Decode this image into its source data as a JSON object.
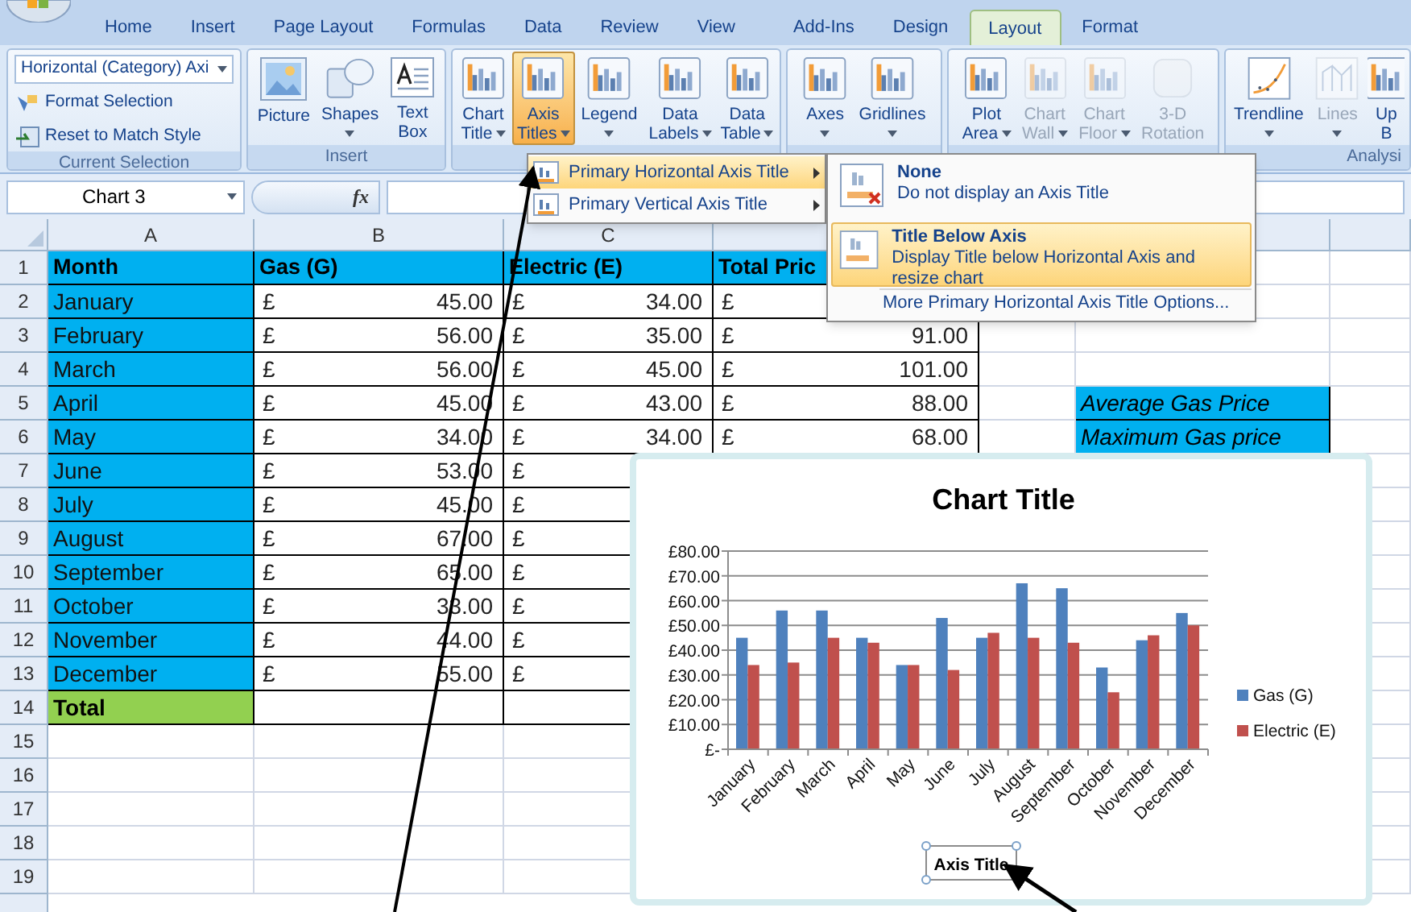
{
  "tabs": [
    {
      "label": "Home",
      "selected": false
    },
    {
      "label": "Insert",
      "selected": false
    },
    {
      "label": "Page Layout",
      "selected": false
    },
    {
      "label": "Formulas",
      "selected": false
    },
    {
      "label": "Data",
      "selected": false
    },
    {
      "label": "Review",
      "selected": false
    },
    {
      "label": "View",
      "selected": false
    },
    {
      "label": "Add-Ins",
      "selected": false
    },
    {
      "label": "Design",
      "selected": false
    },
    {
      "label": "Layout",
      "selected": true
    },
    {
      "label": "Format",
      "selected": false
    }
  ],
  "ribbon": {
    "groups": [
      {
        "kind": "selection",
        "label": "Current Selection",
        "dropdown": "Horizontal (Category) Axi",
        "commands": [
          "Format Selection",
          "Reset to Match Style"
        ]
      },
      {
        "kind": "buttons",
        "label": "Insert",
        "buttons": [
          {
            "kind": "picture",
            "lines": [
              "Picture"
            ],
            "dropdown": false,
            "pressed": false,
            "disabled": false
          },
          {
            "kind": "shapes",
            "lines": [
              "Shapes"
            ],
            "dropdown": true,
            "pressed": false,
            "disabled": false
          },
          {
            "kind": "text",
            "lines": [
              "Text",
              "Box"
            ],
            "dropdown": false,
            "pressed": false,
            "disabled": false
          }
        ]
      },
      {
        "kind": "buttons",
        "buttons": [
          {
            "kind": "chart",
            "lines": [
              "Chart",
              "Title"
            ],
            "dropdown": true,
            "pressed": false,
            "disabled": false
          },
          {
            "kind": "chart",
            "lines": [
              "Axis",
              "Titles"
            ],
            "dropdown": true,
            "pressed": true,
            "disabled": false
          },
          {
            "kind": "chart",
            "lines": [
              "Legend"
            ],
            "dropdown": true,
            "pressed": false,
            "disabled": false
          },
          {
            "kind": "chart",
            "lines": [
              "Data",
              "Labels"
            ],
            "dropdown": true,
            "pressed": false,
            "disabled": false
          },
          {
            "kind": "chart",
            "lines": [
              "Data",
              "Table"
            ],
            "dropdown": true,
            "pressed": false,
            "disabled": false
          }
        ]
      },
      {
        "kind": "buttons",
        "buttons": [
          {
            "kind": "chart",
            "lines": [
              "Axes"
            ],
            "dropdown": true,
            "pressed": false,
            "disabled": false
          },
          {
            "kind": "chart",
            "lines": [
              "Gridlines"
            ],
            "dropdown": true,
            "pressed": false,
            "disabled": false
          }
        ]
      },
      {
        "kind": "buttons",
        "buttons": [
          {
            "kind": "chart",
            "lines": [
              "Plot",
              "Area"
            ],
            "dropdown": true,
            "pressed": false,
            "disabled": false
          },
          {
            "kind": "chart",
            "lines": [
              "Chart",
              "Wall"
            ],
            "dropdown": true,
            "pressed": false,
            "disabled": true
          },
          {
            "kind": "chart",
            "lines": [
              "Chart",
              "Floor"
            ],
            "dropdown": true,
            "pressed": false,
            "disabled": true
          },
          {
            "kind": "cube",
            "lines": [
              "3-D",
              "Rotation"
            ],
            "dropdown": false,
            "pressed": false,
            "disabled": true
          }
        ]
      },
      {
        "kind": "buttons",
        "label": "Analysi",
        "buttons": [
          {
            "kind": "trend",
            "lines": [
              "Trendline"
            ],
            "dropdown": true,
            "pressed": false,
            "disabled": false
          },
          {
            "kind": "lines",
            "lines": [
              "Lines"
            ],
            "dropdown": true,
            "pressed": false,
            "disabled": true
          },
          {
            "kind": "chart",
            "lines": [
              "Up",
              "B"
            ],
            "dropdown": false,
            "pressed": false,
            "disabled": false
          }
        ]
      }
    ]
  },
  "formula_bar": {
    "name_box": "Chart 3",
    "function_label": "fx"
  },
  "sheet": {
    "columns": [
      "A",
      "B",
      "C"
    ],
    "rows": [
      {
        "number": "1",
        "cells": [
          {
            "kind": "header",
            "text": "Month"
          },
          {
            "kind": "header",
            "text": "Gas (G)"
          },
          {
            "kind": "header",
            "text": "Electric (E)"
          },
          {
            "kind": "header",
            "text": "Total Pric"
          },
          {
            "kind": "covered"
          },
          {
            "kind": "partly_covered"
          },
          {
            "kind": "blank"
          }
        ]
      },
      {
        "number": "2",
        "cells": [
          {
            "kind": "month",
            "text": "January"
          },
          {
            "kind": "currency",
            "symbol": "£",
            "value": "45.00"
          },
          {
            "kind": "currency",
            "symbol": "£",
            "value": "34.00"
          },
          {
            "kind": "currency",
            "symbol": "£"
          },
          {
            "kind": "covered"
          },
          {
            "kind": "partly_covered"
          },
          {
            "kind": "blank"
          }
        ]
      },
      {
        "number": "3",
        "cells": [
          {
            "kind": "month",
            "text": "February"
          },
          {
            "kind": "currency",
            "symbol": "£",
            "value": "56.00"
          },
          {
            "kind": "currency",
            "symbol": "£",
            "value": "35.00"
          },
          {
            "kind": "currency",
            "symbol": "£",
            "value": "91.00"
          },
          {
            "kind": "blank"
          },
          {
            "kind": "blank"
          },
          {
            "kind": "blank"
          }
        ]
      },
      {
        "number": "4",
        "cells": [
          {
            "kind": "month",
            "text": "March"
          },
          {
            "kind": "currency",
            "symbol": "£",
            "value": "56.00"
          },
          {
            "kind": "currency",
            "symbol": "£",
            "value": "45.00"
          },
          {
            "kind": "currency",
            "symbol": "£",
            "value": "101.00"
          },
          {
            "kind": "blank"
          },
          {
            "kind": "blank"
          },
          {
            "kind": "blank"
          }
        ]
      },
      {
        "number": "5",
        "cells": [
          {
            "kind": "month",
            "text": "April"
          },
          {
            "kind": "currency",
            "symbol": "£",
            "value": "45.00"
          },
          {
            "kind": "currency",
            "symbol": "£",
            "value": "43.00"
          },
          {
            "kind": "currency",
            "symbol": "£",
            "value": "88.00"
          },
          {
            "kind": "blank"
          },
          {
            "kind": "note",
            "text": "Average Gas Price"
          },
          {
            "kind": "blank"
          }
        ]
      },
      {
        "number": "6",
        "cells": [
          {
            "kind": "month",
            "text": "May"
          },
          {
            "kind": "currency",
            "symbol": "£",
            "value": "34.00"
          },
          {
            "kind": "currency",
            "symbol": "£",
            "value": "34.00"
          },
          {
            "kind": "currency",
            "symbol": "£",
            "value": "68.00"
          },
          {
            "kind": "blank"
          },
          {
            "kind": "note",
            "text": "Maximum Gas price"
          },
          {
            "kind": "blank"
          }
        ]
      },
      {
        "number": "7",
        "cells": [
          {
            "kind": "month",
            "text": "June"
          },
          {
            "kind": "currency",
            "symbol": "£",
            "value": "53.00"
          },
          {
            "kind": "currency",
            "symbol": "£"
          },
          {
            "kind": "covered"
          },
          {
            "kind": "covered"
          },
          {
            "kind": "covered"
          },
          {
            "kind": "blank"
          }
        ]
      },
      {
        "number": "8",
        "cells": [
          {
            "kind": "month",
            "text": "July"
          },
          {
            "kind": "currency",
            "symbol": "£",
            "value": "45.00"
          },
          {
            "kind": "currency",
            "symbol": "£"
          },
          {
            "kind": "covered"
          },
          {
            "kind": "covered"
          },
          {
            "kind": "covered"
          },
          {
            "kind": "blank"
          }
        ]
      },
      {
        "number": "9",
        "cells": [
          {
            "kind": "month",
            "text": "August"
          },
          {
            "kind": "currency",
            "symbol": "£",
            "value": "67.00"
          },
          {
            "kind": "currency",
            "symbol": "£"
          },
          {
            "kind": "covered"
          },
          {
            "kind": "covered"
          },
          {
            "kind": "covered"
          },
          {
            "kind": "blank"
          }
        ]
      },
      {
        "number": "10",
        "cells": [
          {
            "kind": "month",
            "text": "September"
          },
          {
            "kind": "currency",
            "symbol": "£",
            "value": "65.00"
          },
          {
            "kind": "currency",
            "symbol": "£"
          },
          {
            "kind": "covered"
          },
          {
            "kind": "covered"
          },
          {
            "kind": "covered"
          },
          {
            "kind": "blank"
          }
        ]
      },
      {
        "number": "11",
        "cells": [
          {
            "kind": "month",
            "text": "October"
          },
          {
            "kind": "currency",
            "symbol": "£",
            "value": "33.00"
          },
          {
            "kind": "currency",
            "symbol": "£"
          },
          {
            "kind": "covered"
          },
          {
            "kind": "covered"
          },
          {
            "kind": "covered"
          },
          {
            "kind": "blank"
          }
        ]
      },
      {
        "number": "12",
        "cells": [
          {
            "kind": "month",
            "text": "November"
          },
          {
            "kind": "currency",
            "symbol": "£",
            "value": "44.00"
          },
          {
            "kind": "currency",
            "symbol": "£"
          },
          {
            "kind": "covered"
          },
          {
            "kind": "covered"
          },
          {
            "kind": "covered"
          },
          {
            "kind": "blank"
          }
        ]
      },
      {
        "number": "13",
        "cells": [
          {
            "kind": "month",
            "text": "December"
          },
          {
            "kind": "currency",
            "symbol": "£",
            "value": "55.00"
          },
          {
            "kind": "currency",
            "symbol": "£"
          },
          {
            "kind": "covered"
          },
          {
            "kind": "covered"
          },
          {
            "kind": "covered"
          },
          {
            "kind": "blank"
          }
        ]
      },
      {
        "number": "14",
        "cells": [
          {
            "kind": "total",
            "text": "Total"
          },
          {
            "kind": "empty"
          },
          {
            "kind": "empty"
          },
          {
            "kind": "covered"
          },
          {
            "kind": "covered"
          },
          {
            "kind": "covered"
          },
          {
            "kind": "blank"
          }
        ]
      },
      {
        "number": "15",
        "cells": []
      },
      {
        "number": "16",
        "cells": []
      },
      {
        "number": "17",
        "cells": []
      },
      {
        "number": "18",
        "cells": []
      },
      {
        "number": "19",
        "cells": []
      }
    ]
  },
  "axis_titles_menu": {
    "items": [
      {
        "label": "Primary Horizontal Axis Title",
        "selected": true
      },
      {
        "label": "Primary Vertical Axis Title",
        "selected": false
      }
    ]
  },
  "submenu": {
    "options": [
      {
        "kind": "none",
        "title": "None",
        "description": "Do not display an Axis Title",
        "selected": false
      },
      {
        "kind": "below",
        "title": "Title Below Axis",
        "description": "Display Title below Horizontal Axis and resize chart",
        "selected": true
      }
    ],
    "more": "More Primary Horizontal Axis Title Options..."
  },
  "chart": {
    "chart_data": {
      "type": "bar",
      "title": "Chart Title",
      "xlabel": "Axis Title",
      "grid": true,
      "legend": "right",
      "categories": [
        "January",
        "February",
        "March",
        "April",
        "May",
        "June",
        "July",
        "August",
        "September",
        "October",
        "November",
        "December"
      ],
      "series": [
        {
          "name": "Gas (G)",
          "color": "#4f81bd",
          "values": [
            45,
            56,
            56,
            45,
            34,
            53,
            45,
            67,
            65,
            33,
            44,
            55
          ]
        },
        {
          "name": "Electric (E)",
          "color": "#c0504d",
          "values": [
            34,
            35,
            45,
            43,
            34,
            32,
            47,
            45,
            43,
            23,
            46,
            50
          ]
        }
      ],
      "ylim": [
        0,
        80
      ],
      "yticks": [
        {
          "value": 0,
          "label": "£-"
        },
        {
          "value": 10,
          "label": "£10.00"
        },
        {
          "value": 20,
          "label": "£20.00"
        },
        {
          "value": 30,
          "label": "£30.00"
        },
        {
          "value": 40,
          "label": "£40.00"
        },
        {
          "value": 50,
          "label": "£50.00"
        },
        {
          "value": 60,
          "label": "£60.00"
        },
        {
          "value": 70,
          "label": "£70.00"
        },
        {
          "value": 80,
          "label": "£80.00"
        }
      ]
    }
  }
}
